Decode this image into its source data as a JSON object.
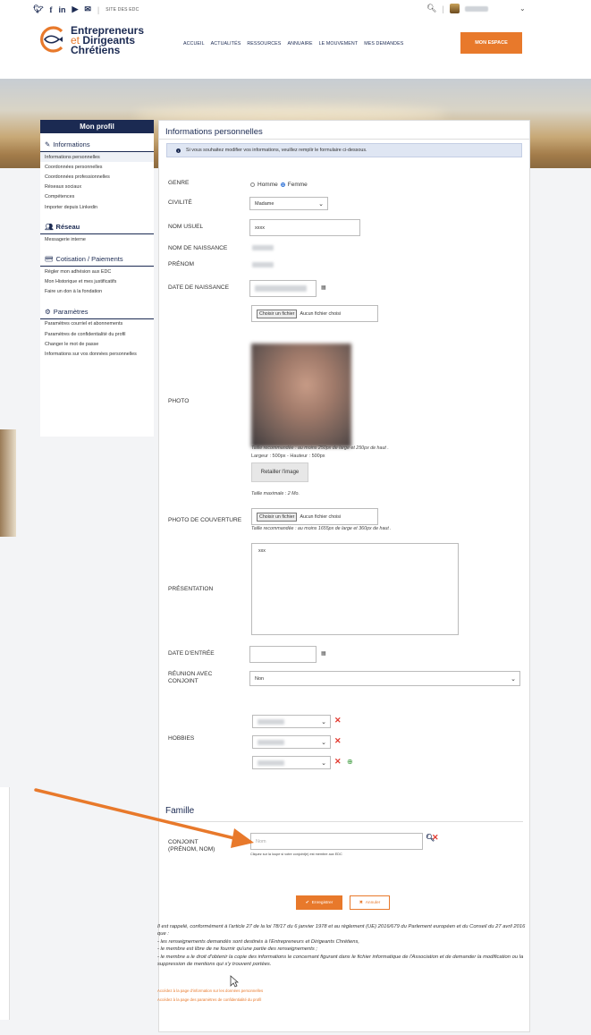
{
  "topbar": {
    "site_label": "SITE DES EDC"
  },
  "brand": {
    "line1": "Entrepreneurs",
    "line2_prefix": "et",
    "line2": "Dirigeants",
    "line3": "Chrétiens"
  },
  "nav": {
    "items": [
      "ACCUEIL",
      "ACTUALITÉS",
      "RESSOURCES",
      "ANNUAIRE",
      "LE MOUVEMENT",
      "MES DEMANDES"
    ],
    "cta": "MON ESPACE"
  },
  "sidebar": {
    "title": "Mon profil",
    "sections": [
      {
        "label": "Informations",
        "items": [
          "Informations personnelles",
          "Coordonnées personnelles",
          "Coordonnées professionnelles",
          "Réseaux sociaux",
          "Compétences",
          "Importer depuis Linkedin"
        ]
      },
      {
        "label": "Réseau",
        "items": [
          "Messagerie interne"
        ]
      },
      {
        "label": "Cotisation / Paiements",
        "items": [
          "Régler mon adhésion aux EDC",
          "Mon Historique et mes justificatifs",
          "Faire un don à la fondation"
        ]
      },
      {
        "label": "Paramètres",
        "items": [
          "Paramètres courriel et abonnements",
          "Paramètres de confidentialité du profil",
          "Changer le mot de passe",
          "Informations sur vos données personnelles"
        ]
      }
    ]
  },
  "main": {
    "title": "Informations personnelles",
    "info": "Si vous souhaitez modifier vos informations, veuillez remplir le formulaire ci-dessous.",
    "labels": {
      "genre": "GENRE",
      "civilite": "CIVILITÉ",
      "nom_usuel": "NOM USUEL",
      "nom_naissance": "NOM DE NAISSANCE",
      "prenom": "PRÉNOM",
      "date_naissance": "DATE DE NAISSANCE",
      "photo": "PHOTO",
      "photo_couverture": "PHOTO DE COUVERTURE",
      "presentation": "PRÉSENTATION",
      "date_entree": "DATE D'ENTRÉE",
      "reunion_line1": "RÉUNION AVEC",
      "reunion_line2": "CONJOINT",
      "hobbies": "HOBBIES",
      "conjoint_line1": "CONJOINT",
      "conjoint_line2": "(PRÉNOM, NOM)"
    },
    "genre": {
      "option1": "Homme",
      "option2": "Femme",
      "selected": "Femme"
    },
    "civilite": "Madame",
    "nom_usuel": "xxxx",
    "file": {
      "button": "Choisir un fichier",
      "status": "Aucun fichier choisi"
    },
    "photo_hint1": "Taille recommandée : au moins 250px de large et 250px de haut .",
    "photo_hint2": "Largeur : 500px - Hauteur : 500px",
    "retail": "Retailler l'image",
    "taille_max": "Taille maximale : 2 Mo.",
    "cover_hint": "Taille recommandée : au moins 1655px de large et 360px de haut .",
    "presentation": "xxx",
    "reunion": "Non",
    "famille": "Famille",
    "conjoint_placeholder": "Nom",
    "conjoint_note": "Cliquez sur la loupe si votre conjoint(e) est membre aux EDC",
    "save": "Enregistrer",
    "cancel": "Annuler",
    "legal": [
      "Il est rappelé, conformément à l'article 27 de la loi 78/17 du 6 janvier 1978 et au règlement (UE) 2016/679 du Parlement européen et du Conseil du 27 avril 2016 que :",
      "- les renseignements demandés sont destinés à l'Entrepreneurs et Dirigeants Chrétiens,",
      "- le membre est libre de ne fournir qu'une partie des renseignements ;",
      "- le membre a le droit d'obtenir la copie des informations le concernant figurant dans le fichier informatique de l'Association et de demander la modification ou la suppression de mentions qui s'y trouvent portées."
    ],
    "link1": "Accédez à la page d'information sur les données personnelles",
    "link2": "Accédez à la page des paramètres de confidentialité du profil"
  },
  "colors": {
    "navy": "#1b2a52",
    "orange": "#e8792b",
    "red": "#e2392e",
    "green": "#3c9a3c"
  }
}
